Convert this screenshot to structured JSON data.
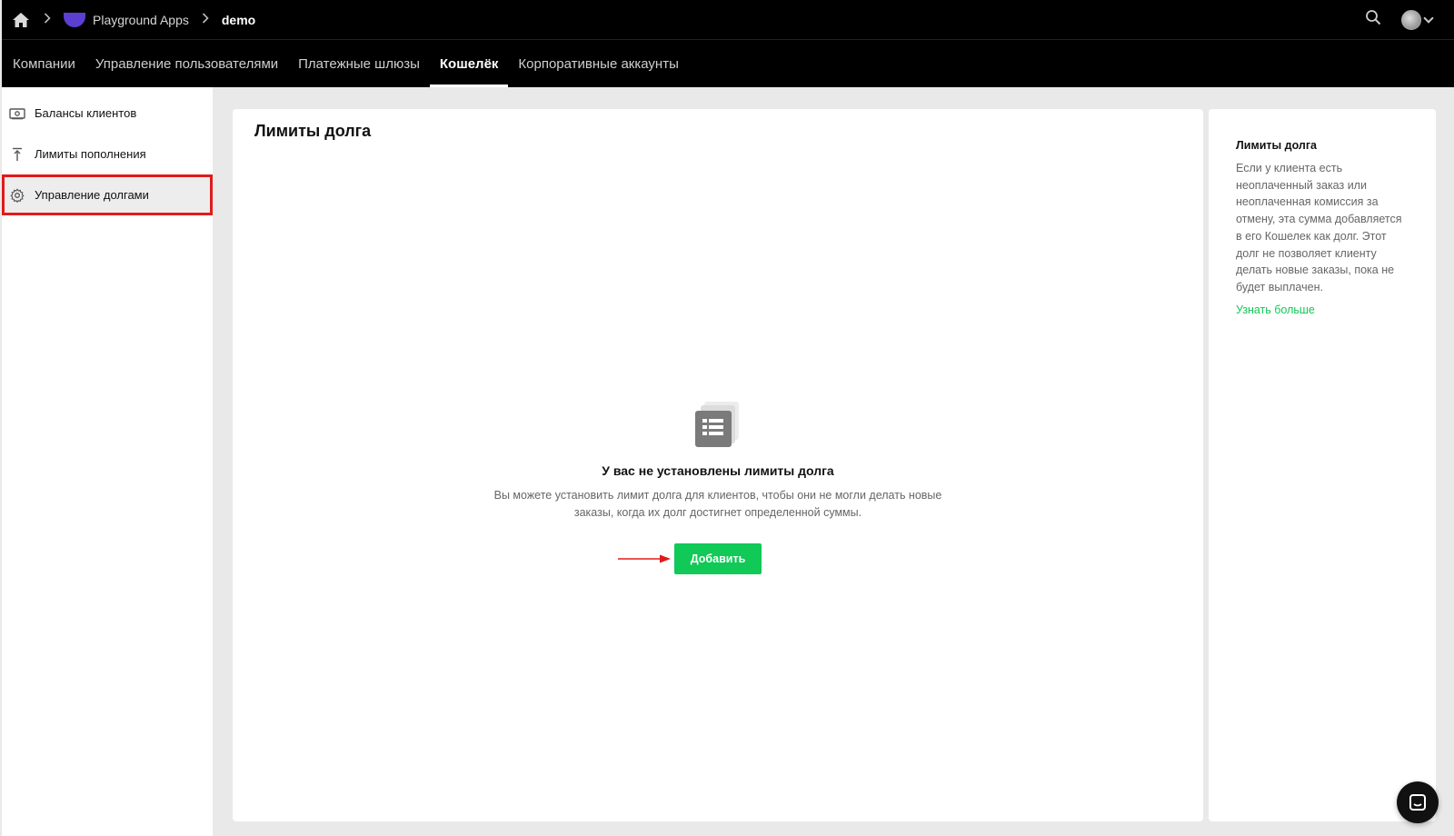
{
  "breadcrumb": {
    "app_name": "Playground Apps",
    "current": "demo"
  },
  "nav": {
    "tabs": [
      {
        "label": "Компании"
      },
      {
        "label": "Управление пользователями"
      },
      {
        "label": "Платежные шлюзы"
      },
      {
        "label": "Кошелёк",
        "active": true
      },
      {
        "label": "Корпоративные аккаунты"
      }
    ]
  },
  "sidebar": {
    "items": [
      {
        "label": "Балансы клиентов",
        "icon": "wallet-icon"
      },
      {
        "label": "Лимиты пополнения",
        "icon": "upload-icon"
      },
      {
        "label": "Управление долгами",
        "icon": "gear-icon",
        "active": true
      }
    ]
  },
  "main": {
    "title": "Лимиты долга",
    "empty": {
      "title": "У вас не установлены лимиты долга",
      "description": "Вы можете установить лимит долга для клиентов, чтобы они не могли делать новые заказы, когда их долг достигнет определенной суммы.",
      "add_label": "Добавить"
    }
  },
  "info": {
    "title": "Лимиты долга",
    "text": "Если у клиента есть неоплаченный заказ или неоплаченная комиссия за отмену, эта сумма добавляется в его Кошелек как долг. Этот долг не позволяет клиенту делать новые заказы, пока не будет выплачен.",
    "link": "Узнать больше"
  },
  "colors": {
    "accent_green": "#10c956",
    "highlight_red": "#e01b1b",
    "topbar": "#000000"
  }
}
